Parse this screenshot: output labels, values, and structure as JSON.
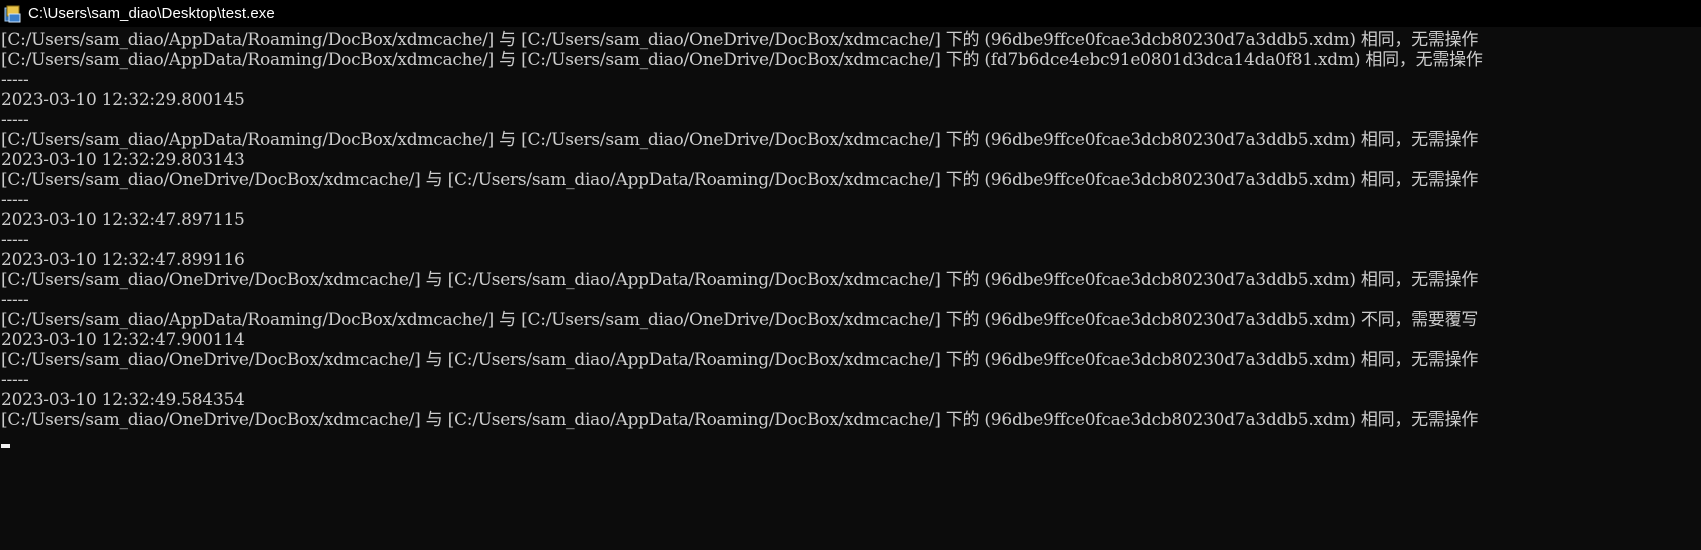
{
  "window": {
    "title": "C:\\Users\\sam_diao\\Desktop\\test.exe",
    "icon": "console-app-icon"
  },
  "console": {
    "lines": [
      "[C:/Users/sam_diao/AppData/Roaming/DocBox/xdmcache/] 与 [C:/Users/sam_diao/OneDrive/DocBox/xdmcache/] 下的 (96dbe9ffce0fcae3dcb80230d7a3ddb5.xdm) 相同，无需操作",
      "[C:/Users/sam_diao/AppData/Roaming/DocBox/xdmcache/] 与 [C:/Users/sam_diao/OneDrive/DocBox/xdmcache/] 下的 (fd7b6dce4ebc91e0801d3dca14da0f81.xdm) 相同，无需操作",
      "-----",
      "2023-03-10 12:32:29.800145",
      "-----",
      "[C:/Users/sam_diao/AppData/Roaming/DocBox/xdmcache/] 与 [C:/Users/sam_diao/OneDrive/DocBox/xdmcache/] 下的 (96dbe9ffce0fcae3dcb80230d7a3ddb5.xdm) 相同，无需操作",
      "2023-03-10 12:32:29.803143",
      "[C:/Users/sam_diao/OneDrive/DocBox/xdmcache/] 与 [C:/Users/sam_diao/AppData/Roaming/DocBox/xdmcache/] 下的 (96dbe9ffce0fcae3dcb80230d7a3ddb5.xdm) 相同，无需操作",
      "-----",
      "2023-03-10 12:32:47.897115",
      "-----",
      "2023-03-10 12:32:47.899116",
      "[C:/Users/sam_diao/OneDrive/DocBox/xdmcache/] 与 [C:/Users/sam_diao/AppData/Roaming/DocBox/xdmcache/] 下的 (96dbe9ffce0fcae3dcb80230d7a3ddb5.xdm) 相同，无需操作",
      "-----",
      "[C:/Users/sam_diao/AppData/Roaming/DocBox/xdmcache/] 与 [C:/Users/sam_diao/OneDrive/DocBox/xdmcache/] 下的 (96dbe9ffce0fcae3dcb80230d7a3ddb5.xdm) 不同，需要覆写",
      "2023-03-10 12:32:47.900114",
      "[C:/Users/sam_diao/OneDrive/DocBox/xdmcache/] 与 [C:/Users/sam_diao/AppData/Roaming/DocBox/xdmcache/] 下的 (96dbe9ffce0fcae3dcb80230d7a3ddb5.xdm) 相同，无需操作",
      "-----",
      "2023-03-10 12:32:49.584354",
      "[C:/Users/sam_diao/OneDrive/DocBox/xdmcache/] 与 [C:/Users/sam_diao/AppData/Roaming/DocBox/xdmcache/] 下的 (96dbe9ffce0fcae3dcb80230d7a3ddb5.xdm) 相同，无需操作"
    ]
  },
  "colors": {
    "background": "#0c0c0c",
    "foreground": "#cccccc",
    "title_text": "#ffffff"
  }
}
